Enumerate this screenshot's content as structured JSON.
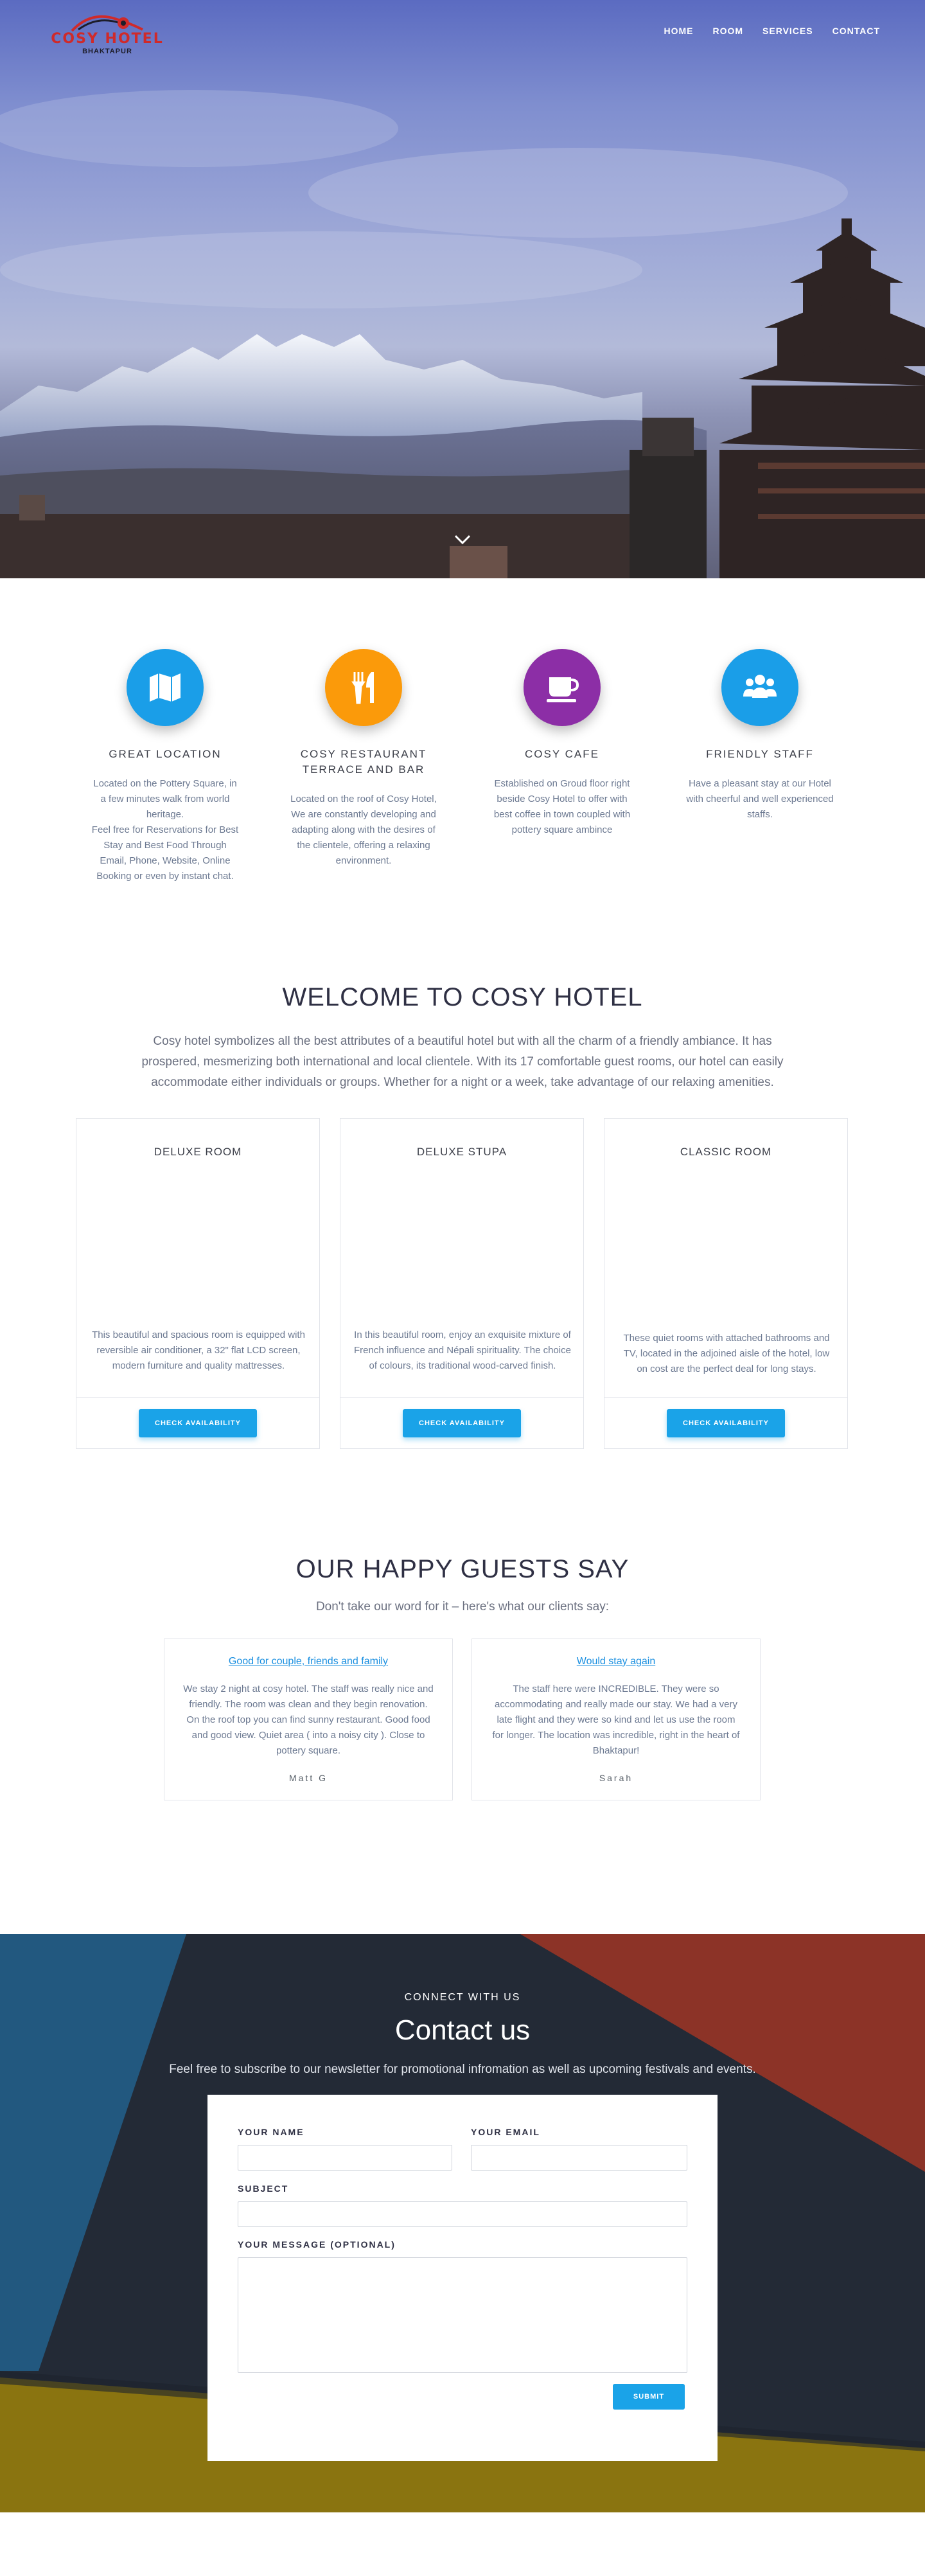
{
  "brand": {
    "name": "COSY HOTEL",
    "location": "BHAKTAPUR"
  },
  "nav": {
    "items": [
      "HOME",
      "ROOM",
      "SERVICES",
      "CONTACT"
    ]
  },
  "features": [
    {
      "title": "GREAT LOCATION",
      "icon": "map-icon",
      "color": "#1a9ee8",
      "text": "Located on the Pottery Square, in a few minutes walk from world heritage.\nFeel free for Reservations for Best Stay and Best Food Through Email, Phone, Website, Online Booking or even by instant chat."
    },
    {
      "title": "COSY RESTAURANT TERRACE AND BAR",
      "icon": "cutlery-icon",
      "color": "#fb9a0a",
      "text": "Located on the roof of Cosy Hotel, We are constantly developing and adapting along with the desires of the clientele, offering a relaxing environment."
    },
    {
      "title": "COSY CAFE",
      "icon": "coffee-cup-icon",
      "color": "#8c2ea6",
      "text": "Established on Groud floor right beside Cosy Hotel to offer with best coffee in town coupled with pottery square ambince"
    },
    {
      "title": "FRIENDLY STAFF",
      "icon": "users-icon",
      "color": "#1a9ee8",
      "text": "Have a pleasant stay at our Hotel with cheerful and well experienced staffs."
    }
  ],
  "welcome": {
    "title": "WELCOME TO COSY HOTEL",
    "intro": "Cosy hotel symbolizes all the best attributes of a beautiful hotel but with all the charm of a friendly ambiance. It has prospered, mesmerizing both international and local clientele. With its 17 comfortable guest rooms, our hotel can easily accommodate either individuals or groups. Whether for a night or a week, take advantage of our relaxing amenities."
  },
  "rooms": [
    {
      "name": "DELUXE ROOM",
      "description": "This beautiful and spacious room is equipped with reversible air conditioner, a 32\" flat LCD screen, modern furniture and quality mattresses.",
      "button": "CHECK AVAILABILITY"
    },
    {
      "name": "DELUXE STUPA",
      "description": "In this beautiful room, enjoy an exquisite mixture of French influence and Népali spirituality. The choice of colours, its traditional wood-carved finish.",
      "button": "CHECK AVAILABILITY"
    },
    {
      "name": "CLASSIC ROOM",
      "description": "These quiet rooms with attached bathrooms and TV, located in the adjoined aisle of the hotel, low on cost are the perfect deal for long stays.",
      "button": "CHECK AVAILABILITY"
    }
  ],
  "guests": {
    "title": "OUR HAPPY GUESTS SAY",
    "lead": "Don't take our word for it – here's what our clients say:",
    "testimonials": [
      {
        "title": "Good for couple, friends and family",
        "body": "We stay 2 night at cosy hotel. The staff was really nice and friendly. The room was clean and they begin renovation. On the roof top you can find sunny restaurant. Good food and good view. Quiet area ( into a noisy city ). Close to pottery square.",
        "author": "Matt G"
      },
      {
        "title": "Would stay again",
        "body": "The staff here were INCREDIBLE. They were so accommodating and really made our stay. We had a very late flight and they were so kind and let us use the room for longer. The location was incredible, right in the heart of Bhaktapur!",
        "author": "Sarah"
      }
    ]
  },
  "contact": {
    "kicker": "CONNECT WITH US",
    "title": "Contact us",
    "note": "Feel free to subscribe to our newsletter for promotional infromation as well as upcoming festivals and events.",
    "form": {
      "name_label": "YOUR NAME",
      "email_label": "YOUR EMAIL",
      "subject_label": "SUBJECT",
      "message_label": "YOUR MESSAGE (OPTIONAL)",
      "name_value": "",
      "email_value": "",
      "subject_value": "",
      "message_value": "",
      "submit_label": "SUBMIT"
    }
  },
  "colors": {
    "accent": "#1aa3e8",
    "heading": "#2f3044",
    "brand_red": "#cf2a2a"
  }
}
